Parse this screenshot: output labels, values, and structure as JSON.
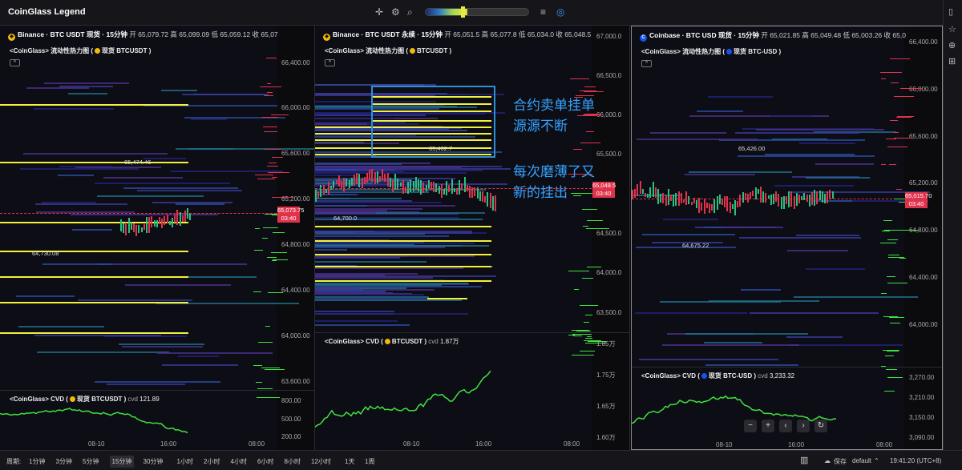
{
  "app": {
    "title": "CoinGlass Legend"
  },
  "panels": [
    {
      "header": {
        "exchange": "Binance · BTC USDT 现货 · 15分钟",
        "open": "开 65,079.72",
        "high": "高 65,099.09",
        "low": "低 65,059.12",
        "close": "收 65,07"
      },
      "heatmap_label": "<CoinGlass> 流动性热力图 (",
      "heatmap_source": "现货 BTCUSDT )",
      "y_labels": [
        "66,400.00",
        "66,000.00",
        "65,600.00",
        "65,200.00",
        "64,800.00",
        "64,400.00",
        "64,000.00",
        "63,600.00"
      ],
      "price_tag": "65,073.75",
      "time_tag": "03:40",
      "high_label": "65,474.46",
      "low_label": "64,730.08",
      "cvd_label": "<CoinGlass> CVD (",
      "cvd_source": "现货 BTCUSDT )",
      "cvd_value_label": "cvd",
      "cvd_value": "121.89",
      "cvd_y_labels": [
        "800.00",
        "500.00",
        "200.00"
      ],
      "x_labels": [
        "08-10",
        "16:00",
        "08:00"
      ]
    },
    {
      "header": {
        "exchange": "Binance · BTC USDT 永续 · 15分钟",
        "open": "开 65,051.5",
        "high": "高 65,077.8",
        "low": "低 65,034.0",
        "close": "收 65,048.5"
      },
      "heatmap_label": "<CoinGlass> 流动性热力图 (",
      "heatmap_source": "BTCUSDT )",
      "y_labels": [
        "67,000.0",
        "66,500.0",
        "66,000.0",
        "65,500.0",
        "64,500.0",
        "64,000.0",
        "63,500.0"
      ],
      "price_tag": "65,048.5",
      "time_tag": "03:40",
      "high_label": "65,482.7",
      "low_label": "64,700.0",
      "cvd_label": "<CoinGlass> CVD (",
      "cvd_source": "BTCUSDT )",
      "cvd_value_label": "cvd",
      "cvd_value": "1.87万",
      "cvd_y_labels": [
        "1.85万",
        "1.75万",
        "1.65万",
        "1.60万"
      ],
      "x_labels": [
        "08-10",
        "16:00",
        "08:00"
      ]
    },
    {
      "header": {
        "exchange": "Coinbase · BTC USD 现货 · 15分钟",
        "open": "开 65,021.85",
        "high": "高 65,049.48",
        "low": "低 65,003.26",
        "close": "收 65,0"
      },
      "heatmap_label": "<CoinGlass> 流动性热力图 (",
      "heatmap_source": "现货 BTC-USD )",
      "y_labels": [
        "66,400.00",
        "66,000.00",
        "65,600.00",
        "65,200.00",
        "64,800.00",
        "64,400.00",
        "64,000.00"
      ],
      "price_tag": "65,015.70",
      "time_tag": "03:40",
      "high_label": "65,426.00",
      "low_label": "64,675.22",
      "cvd_label": "<CoinGlass> CVD (",
      "cvd_source": "现货 BTC-USD )",
      "cvd_value_label": "cvd",
      "cvd_value": "3,233.32",
      "cvd_y_labels": [
        "3,270.00",
        "3,210.00",
        "3,150.00",
        "3,090.00"
      ],
      "x_labels": [
        "08-10",
        "16:00",
        "08:00"
      ]
    }
  ],
  "annotation": {
    "line1": "合约卖单挂单",
    "line2": "源源不断",
    "line3": "每次磨薄了又",
    "line4": "新的挂出"
  },
  "nav": {
    "minus": "−",
    "plus": "+",
    "left": "‹",
    "right": "›",
    "reset": "↻"
  },
  "bottom": {
    "period_label": "周期:",
    "timeframes": [
      "1分钟",
      "3分钟",
      "5分钟",
      "15分钟",
      "30分钟",
      "1小时",
      "2小时",
      "4小时",
      "6小时",
      "8小时",
      "12小时",
      "1天",
      "1周"
    ],
    "active_timeframe": "15分钟",
    "save": "保存",
    "layout": "default",
    "clock": "19:41:20 (UTC+8)"
  },
  "colors": {
    "bull": "#26c281",
    "bear": "#e0334b",
    "heat_strong": "#f2f23a",
    "cvd": "#3fe23f",
    "callout": "#2e8fd8"
  }
}
